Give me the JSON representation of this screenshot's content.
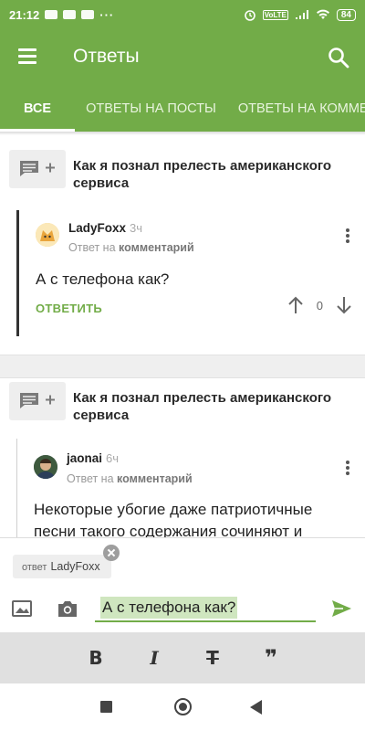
{
  "status_bar": {
    "time": "21:12",
    "dots": "···",
    "network": "VoLTE",
    "battery": "84"
  },
  "app_bar": {
    "title": "Ответы"
  },
  "tabs": [
    {
      "label": "ВСЕ",
      "active": true
    },
    {
      "label": "ОТВЕТЫ НА ПОСТЫ",
      "active": false
    },
    {
      "label": "ОТВЕТЫ НА КОММЕНТАРИИ",
      "active": false
    }
  ],
  "posts": [
    {
      "title": "Как я познал прелесть американского сервиса",
      "comment": {
        "author": "LadyFoxx",
        "time": "3ч",
        "reply_prefix": "Ответ на",
        "reply_target": "комментарий",
        "text": "А с телефона как?",
        "reply_label": "ОТВЕТИТЬ",
        "rating": "0"
      }
    },
    {
      "title": "Как я познал прелесть американского сервиса",
      "comment": {
        "author": "jaonai",
        "time": "6ч",
        "reply_prefix": "Ответ на",
        "reply_target": "комментарий",
        "text": "Некоторые убогие даже патриотичные песни такого содержания сочиняют и"
      }
    }
  ],
  "reply_composer": {
    "chip_prefix": "ответ",
    "chip_user": "LadyFoxx",
    "input_value": "А с телефона как?"
  },
  "format_toolbar": {
    "bold": "B",
    "italic": "I",
    "strike": "T",
    "quote": "❞"
  },
  "colors": {
    "accent": "#72ac48",
    "toolbar_bg": "#e0e0e0"
  }
}
